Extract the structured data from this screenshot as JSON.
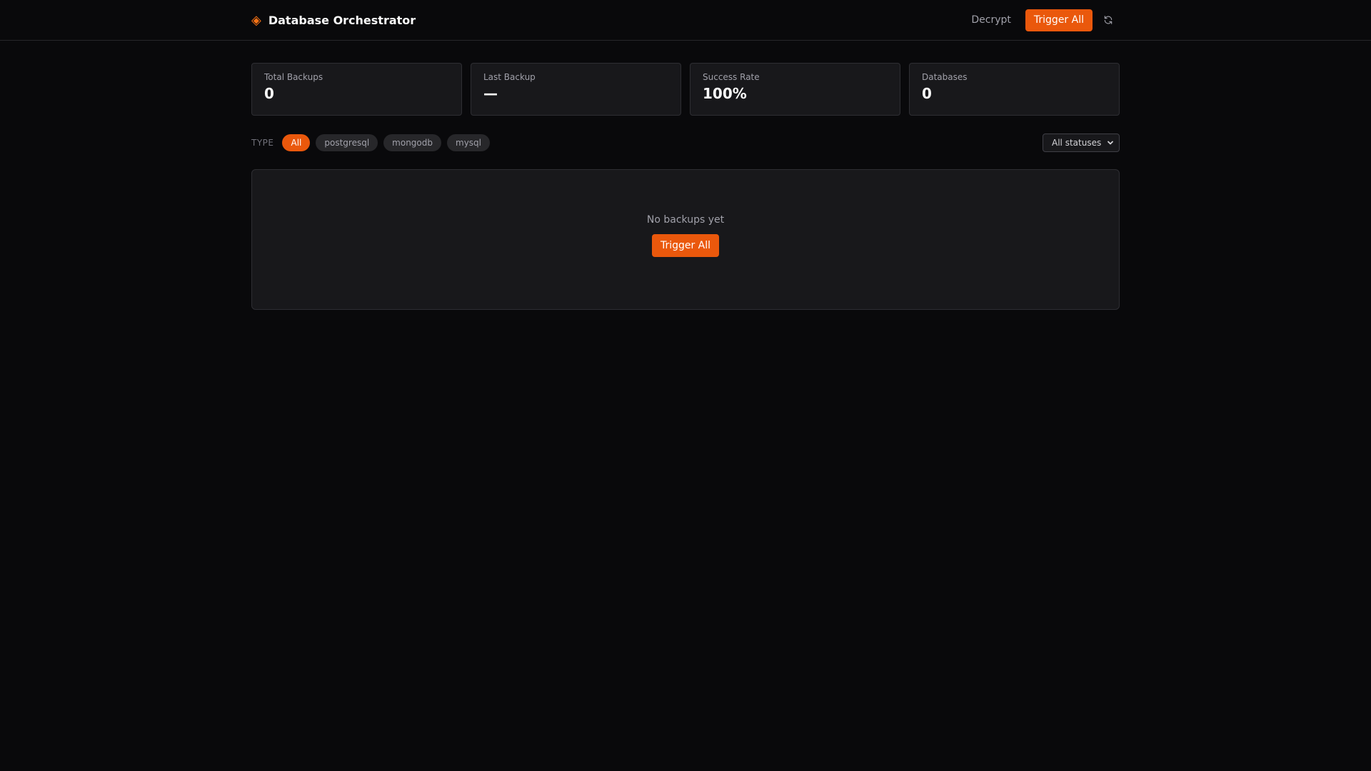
{
  "header": {
    "brand_icon": "diamond-icon",
    "title": "Database Orchestrator",
    "decrypt_label": "Decrypt",
    "trigger_all_label": "Trigger All",
    "refresh_icon": "refresh-icon"
  },
  "stats": [
    {
      "label": "Total Backups",
      "value": "0"
    },
    {
      "label": "Last Backup",
      "value": "—"
    },
    {
      "label": "Success Rate",
      "value": "100%"
    },
    {
      "label": "Databases",
      "value": "0"
    }
  ],
  "filters": {
    "type_label": "TYPE",
    "chips": [
      "All",
      "postgresql",
      "mongodb",
      "mysql"
    ],
    "active_chip": "All",
    "status_select_value": "All statuses"
  },
  "empty_state": {
    "message": "No backups yet",
    "button_label": "Trigger All"
  },
  "colors": {
    "background": "#09090b",
    "card": "#18181b",
    "accent": "#ea580c",
    "accent_icon": "#f97316"
  }
}
